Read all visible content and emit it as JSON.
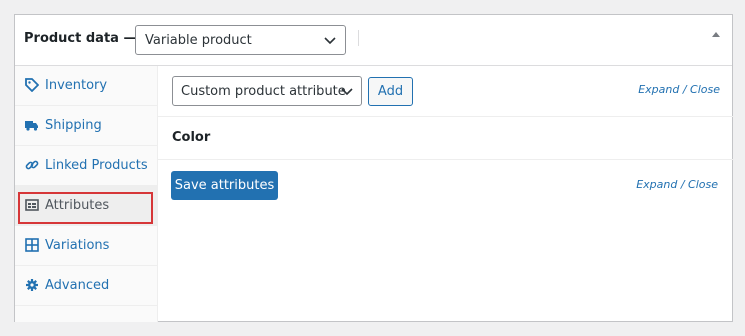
{
  "header": {
    "title": "Product data —",
    "product_type": "Variable product"
  },
  "tabs": [
    {
      "label": "Inventory",
      "icon": "tag-icon"
    },
    {
      "label": "Shipping",
      "icon": "truck-icon"
    },
    {
      "label": "Linked Products",
      "icon": "link-icon"
    },
    {
      "label": "Attributes",
      "icon": "list-view-icon"
    },
    {
      "label": "Variations",
      "icon": "grid-icon"
    },
    {
      "label": "Advanced",
      "icon": "gear-icon"
    }
  ],
  "active_tab": "Attributes",
  "attributes": {
    "select_value": "Custom product attribute",
    "add_label": "Add",
    "expand_close": "Expand / Close",
    "attribute_name": "Color",
    "save_label": "Save attributes",
    "expand_close_bottom": "Expand / Close"
  },
  "colors": {
    "accent": "#2271b1",
    "highlight": "#d63638"
  }
}
